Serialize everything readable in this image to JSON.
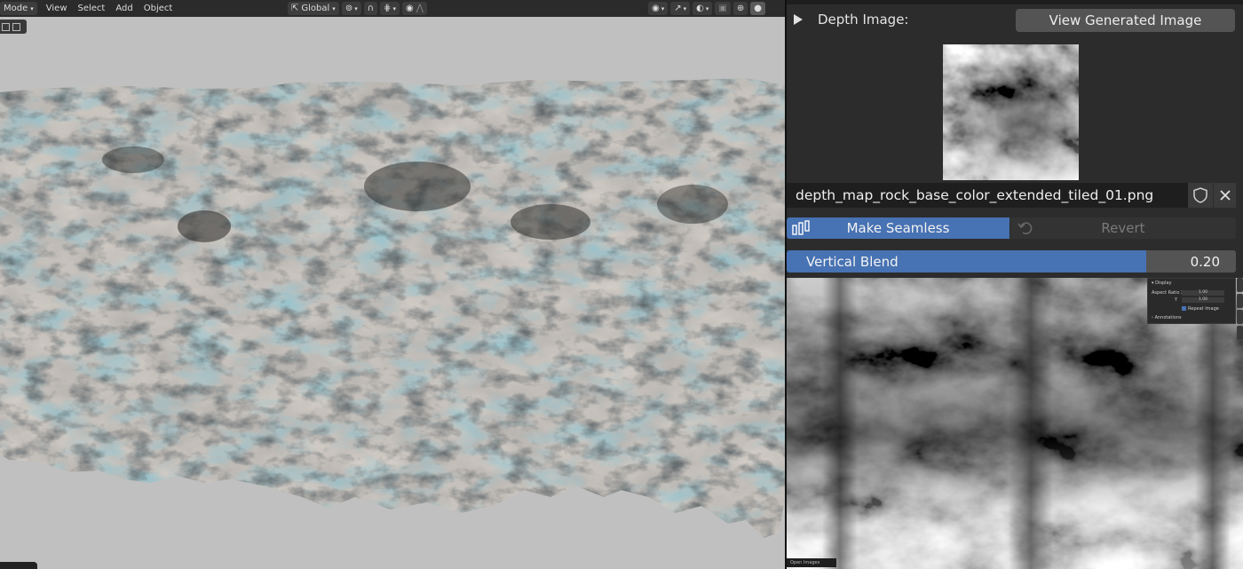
{
  "viewport": {
    "header": {
      "mode_label": "Mode",
      "menu": [
        "View",
        "Select",
        "Add",
        "Object"
      ],
      "orientation_label": "Global"
    }
  },
  "panel": {
    "depth_label": "Depth Image:",
    "view_button_label": "View Generated Image",
    "filename": "depth_map_rock_base_color_extended_tiled_01.png",
    "make_seamless_label": "Make Seamless",
    "revert_label": "Revert",
    "blend": {
      "label": "Vertical Blend",
      "value_text": "0.20",
      "fill_fraction": 0.8
    },
    "mini_panel": {
      "display_label": "Display",
      "aspect_label": "Aspect Ratio X",
      "aspect_y_label": "Y",
      "aspect_x_value": "1.00",
      "aspect_y_value": "1.00",
      "repeat_label": "Repeat Image",
      "annotations_label": "Annotations"
    },
    "open_images_label": "Open Images"
  },
  "colors": {
    "accent": "#4772b3",
    "panel_bg": "#2c2c2c",
    "viewport_bg": "#c0c0c0"
  }
}
